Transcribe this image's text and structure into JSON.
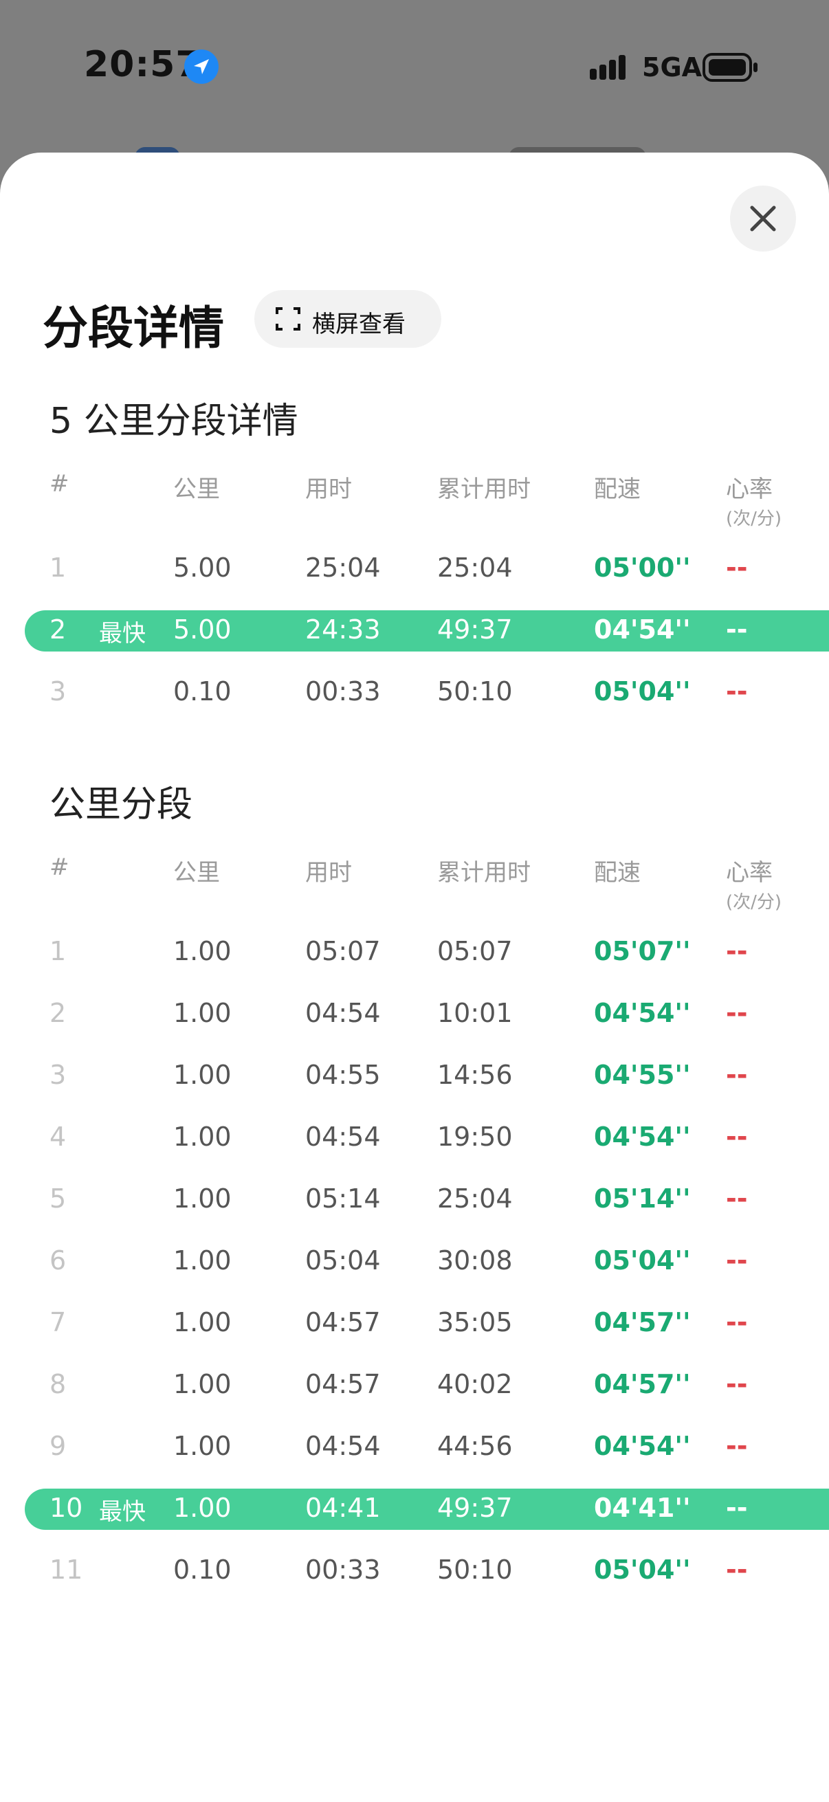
{
  "status": {
    "time": "20:57",
    "network": "5GA",
    "icons": [
      "location-arrow-icon",
      "signal-icon",
      "battery-icon"
    ]
  },
  "sheet": {
    "title": "分段详情",
    "landscape_button": "横屏查看",
    "close_icon": "close-icon"
  },
  "headers": {
    "idx": "#",
    "km": "公里",
    "time": "用时",
    "cumulative": "累计用时",
    "pace": "配速",
    "hr": "心率",
    "hr_unit": "(次/分)"
  },
  "colors": {
    "accent": "#47cf98",
    "pace": "#1aaa72",
    "heart_rate": "#e0464c"
  },
  "section5k": {
    "title": "5 公里分段详情",
    "rows": [
      {
        "idx": "1",
        "tag": "",
        "km": "5.00",
        "time": "25:04",
        "cum": "25:04",
        "pace": "05'00''",
        "hr": "--"
      },
      {
        "idx": "2",
        "tag": "最快",
        "km": "5.00",
        "time": "24:33",
        "cum": "49:37",
        "pace": "04'54''",
        "hr": "--"
      },
      {
        "idx": "3",
        "tag": "",
        "km": "0.10",
        "time": "00:33",
        "cum": "50:10",
        "pace": "05'04''",
        "hr": "--"
      }
    ]
  },
  "section1k": {
    "title": "公里分段",
    "rows": [
      {
        "idx": "1",
        "tag": "",
        "km": "1.00",
        "time": "05:07",
        "cum": "05:07",
        "pace": "05'07''",
        "hr": "--"
      },
      {
        "idx": "2",
        "tag": "",
        "km": "1.00",
        "time": "04:54",
        "cum": "10:01",
        "pace": "04'54''",
        "hr": "--"
      },
      {
        "idx": "3",
        "tag": "",
        "km": "1.00",
        "time": "04:55",
        "cum": "14:56",
        "pace": "04'55''",
        "hr": "--"
      },
      {
        "idx": "4",
        "tag": "",
        "km": "1.00",
        "time": "04:54",
        "cum": "19:50",
        "pace": "04'54''",
        "hr": "--"
      },
      {
        "idx": "5",
        "tag": "",
        "km": "1.00",
        "time": "05:14",
        "cum": "25:04",
        "pace": "05'14''",
        "hr": "--"
      },
      {
        "idx": "6",
        "tag": "",
        "km": "1.00",
        "time": "05:04",
        "cum": "30:08",
        "pace": "05'04''",
        "hr": "--"
      },
      {
        "idx": "7",
        "tag": "",
        "km": "1.00",
        "time": "04:57",
        "cum": "35:05",
        "pace": "04'57''",
        "hr": "--"
      },
      {
        "idx": "8",
        "tag": "",
        "km": "1.00",
        "time": "04:57",
        "cum": "40:02",
        "pace": "04'57''",
        "hr": "--"
      },
      {
        "idx": "9",
        "tag": "",
        "km": "1.00",
        "time": "04:54",
        "cum": "44:56",
        "pace": "04'54''",
        "hr": "--"
      },
      {
        "idx": "10",
        "tag": "最快",
        "km": "1.00",
        "time": "04:41",
        "cum": "49:37",
        "pace": "04'41''",
        "hr": "--"
      },
      {
        "idx": "11",
        "tag": "",
        "km": "0.10",
        "time": "00:33",
        "cum": "50:10",
        "pace": "05'04''",
        "hr": "--"
      }
    ]
  }
}
